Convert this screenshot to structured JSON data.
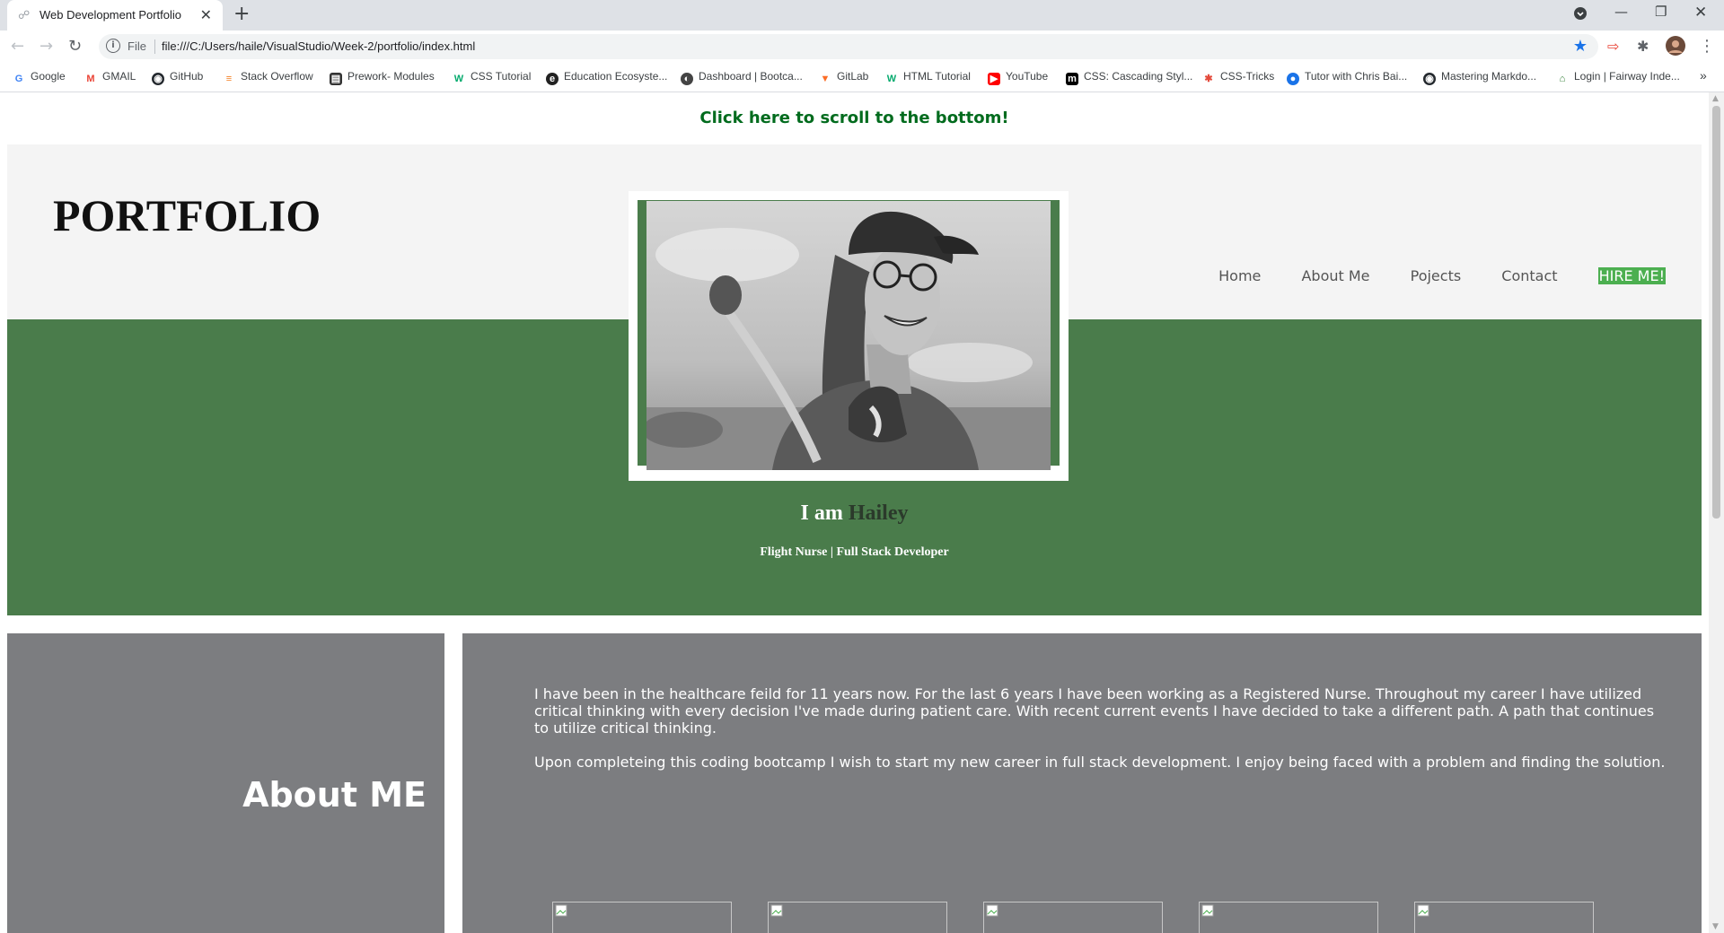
{
  "browser": {
    "tab_title": "Web Development Portfolio",
    "address_scheme": "File",
    "url": "file:///C:/Users/haile/VisualStudio/Week-2/portfolio/index.html",
    "bookmarks": [
      {
        "label": "Google",
        "icon": "google-icon",
        "color": "#4285f4"
      },
      {
        "label": "GMAIL",
        "icon": "gmail-icon",
        "color": "#ea4335"
      },
      {
        "label": "GitHub",
        "icon": "github-icon",
        "color": "#24292e"
      },
      {
        "label": "Stack Overflow",
        "icon": "stackoverflow-icon",
        "color": "#f48024"
      },
      {
        "label": "Prework- Modules",
        "icon": "book-icon",
        "color": "#333333"
      },
      {
        "label": "CSS Tutorial",
        "icon": "w3schools-icon",
        "color": "#04aa6d"
      },
      {
        "label": "Education Ecosyste...",
        "icon": "edu-icon",
        "color": "#222222"
      },
      {
        "label": "Dashboard | Bootca...",
        "icon": "dashboard-icon",
        "color": "#444444"
      },
      {
        "label": "GitLab",
        "icon": "gitlab-icon",
        "color": "#fc6d26"
      },
      {
        "label": "HTML Tutorial",
        "icon": "w3schools-icon",
        "color": "#04aa6d"
      },
      {
        "label": "YouTube",
        "icon": "youtube-icon",
        "color": "#ff0000"
      },
      {
        "label": "CSS: Cascading Styl...",
        "icon": "mdn-icon",
        "color": "#000000"
      },
      {
        "label": "CSS-Tricks",
        "icon": "csstricks-icon",
        "color": "#e44b3c"
      },
      {
        "label": "Tutor with Chris Bai...",
        "icon": "tutor-icon",
        "color": "#1a73e8"
      },
      {
        "label": "Mastering Markdo...",
        "icon": "github-icon",
        "color": "#24292e"
      },
      {
        "label": "Login | Fairway Inde...",
        "icon": "fairway-icon",
        "color": "#2e7d32"
      }
    ],
    "more_bookmarks": "»"
  },
  "page": {
    "scroll_link": "Click here to scroll to the bottom!",
    "brand": "PORTFOLIO",
    "nav": [
      "Home",
      "About Me",
      "Pojects",
      "Contact"
    ],
    "hire": "HIRE ME!",
    "intro_prefix": "I am",
    "intro_name": "Hailey",
    "subtitle": "Flight Nurse | Full Stack Developer",
    "about_heading": "About ME",
    "about_paragraphs": [
      "I have been in the healthcare feild for 11 years now. For the last 6 years I have been working as a Registered Nurse. Throughout my career I have utilized critical thinking with every decision I've made during patient care. With recent current events I have decided to take a different path. A path that continues to utilize critical thinking.",
      "Upon completeing this coding bootcamp I wish to start my new career in full stack development. I enjoy being faced with a problem and finding the solution."
    ],
    "project_image_count": 5
  },
  "colors": {
    "hero_green": "#4a7c4b",
    "link_green": "#006b1d",
    "hire_green": "#4caf50",
    "panel_gray": "#7c7d80",
    "header_bg": "#f4f4f4"
  }
}
